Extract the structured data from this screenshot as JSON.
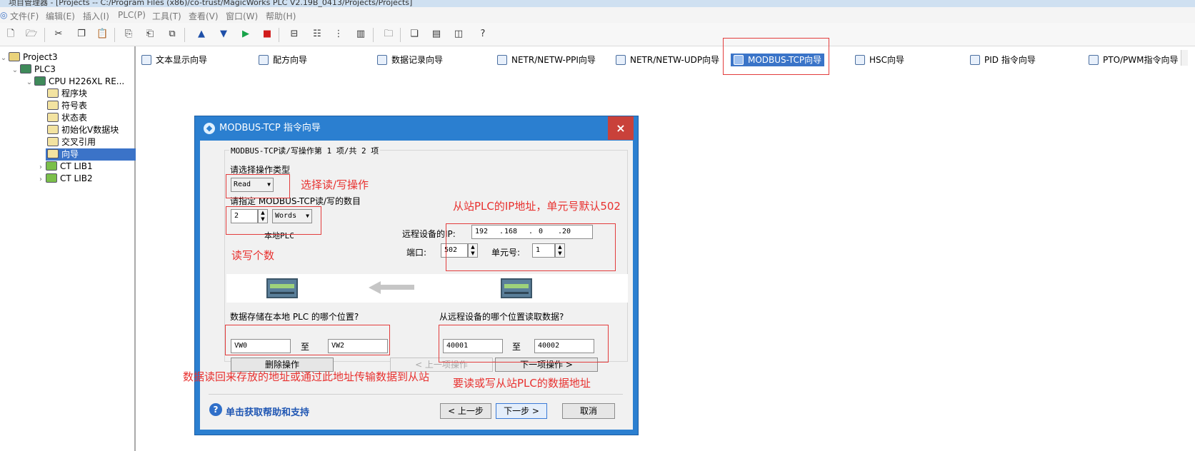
{
  "window": {
    "title": "项目管理器 - [Projects -- C:/Program Files (x86)/co-trust/MagicWorks PLC V2.19B_0413/Projects/Projects]"
  },
  "menu": [
    "文件(F)",
    "编辑(E)",
    "插入(I)",
    "PLC(P)",
    "工具(T)",
    "查看(V)",
    "窗口(W)",
    "帮助(H)"
  ],
  "toolbar": {
    "icons": [
      "new-file-icon",
      "open-folder-icon",
      "cut-icon",
      "copy-icon",
      "paste-icon",
      "import-icon",
      "export-icon",
      "compile-icon",
      "upload-icon",
      "download-icon",
      "run-icon",
      "stop-icon",
      "status-icon",
      "tree-icon",
      "list-icon",
      "table-icon",
      "folder-up-icon",
      "window-icon",
      "layout-icon",
      "split-icon",
      "help-context-icon"
    ]
  },
  "tree": [
    {
      "label": "Project3",
      "icon": "project-icon"
    },
    {
      "label": "PLC3",
      "icon": "plc-icon"
    },
    {
      "label": "CPU H226XL RE...",
      "icon": "cpu-icon"
    },
    {
      "label": "程序块",
      "icon": "program-block-icon"
    },
    {
      "label": "符号表",
      "icon": "symbol-table-icon"
    },
    {
      "label": "状态表",
      "icon": "status-table-icon"
    },
    {
      "label": "初始化V数据块",
      "icon": "data-block-icon"
    },
    {
      "label": "交叉引用",
      "icon": "cross-reference-icon"
    },
    {
      "label": "向导",
      "icon": "wizard-icon",
      "selected": true
    },
    {
      "label": "CT LIB1",
      "icon": "library-icon"
    },
    {
      "label": "CT LIB2",
      "icon": "library-icon"
    }
  ],
  "wizards": [
    {
      "label": "文本显示向导",
      "icon": "text-display-icon"
    },
    {
      "label": "配方向导",
      "icon": "recipe-icon"
    },
    {
      "label": "数据记录向导",
      "icon": "data-log-icon"
    },
    {
      "label": "NETR/NETW-PPI向导",
      "icon": "document-icon"
    },
    {
      "label": "NETR/NETW-UDP向导",
      "icon": "document-icon"
    },
    {
      "label": "MODBUS-TCP向导",
      "icon": "network-icon",
      "selected": true
    },
    {
      "label": "HSC向导",
      "icon": "document-icon"
    },
    {
      "label": "PID 指令向导",
      "icon": "document-icon"
    },
    {
      "label": "PTO/PWM指令向导",
      "icon": "document-icon"
    }
  ],
  "dialog": {
    "title": "MODBUS-TCP 指令向导",
    "close": "×",
    "group_title": "MODBUS-TCP读/写操作第 1 项/共 2 项",
    "op_type_label": "请选择操作类型",
    "op_type_value": "Read",
    "count_label": "请指定 MODBUS-TCP读/写的数目",
    "count_value": "2",
    "unit_value": "Words",
    "local_plc_label": "本地PLC",
    "remote_ip_label": "远程设备的IP:",
    "ip": [
      "192",
      "168",
      "0",
      "20"
    ],
    "ip_dot": ".",
    "port_label": "端口:",
    "port_value": "502",
    "unit_id_label": "单元号:",
    "unit_id_value": "1",
    "local_store_label": "数据存储在本地 PLC 的哪个位置?",
    "local_from": "VW0",
    "to_label": "至",
    "local_to": "VW2",
    "remote_read_label": "从远程设备的哪个位置读取数据?",
    "remote_from": "40001",
    "remote_to": "40002",
    "delete_btn": "删除操作",
    "prev_op_btn": "< 上一项操作",
    "next_op_btn": "下一项操作 >",
    "help_link": "单击获取帮助和支持",
    "back_btn": "< 上一步",
    "next_btn": "下一步 >",
    "cancel_btn": "取消"
  },
  "annotations": {
    "op_select": "选择读/写操作",
    "slave_ip": "从站PLC的IP地址，单元号默认502",
    "rw_count": "读写个数",
    "local_addr": "数据读回来存放的地址或通过此地址传输数据到从站",
    "remote_addr": "要读或写从站PLC的数据地址"
  },
  "colors": {
    "dialog_title_bar": "#2b7fd0",
    "selection": "#3b73c8",
    "annotation": "#e8312f"
  }
}
